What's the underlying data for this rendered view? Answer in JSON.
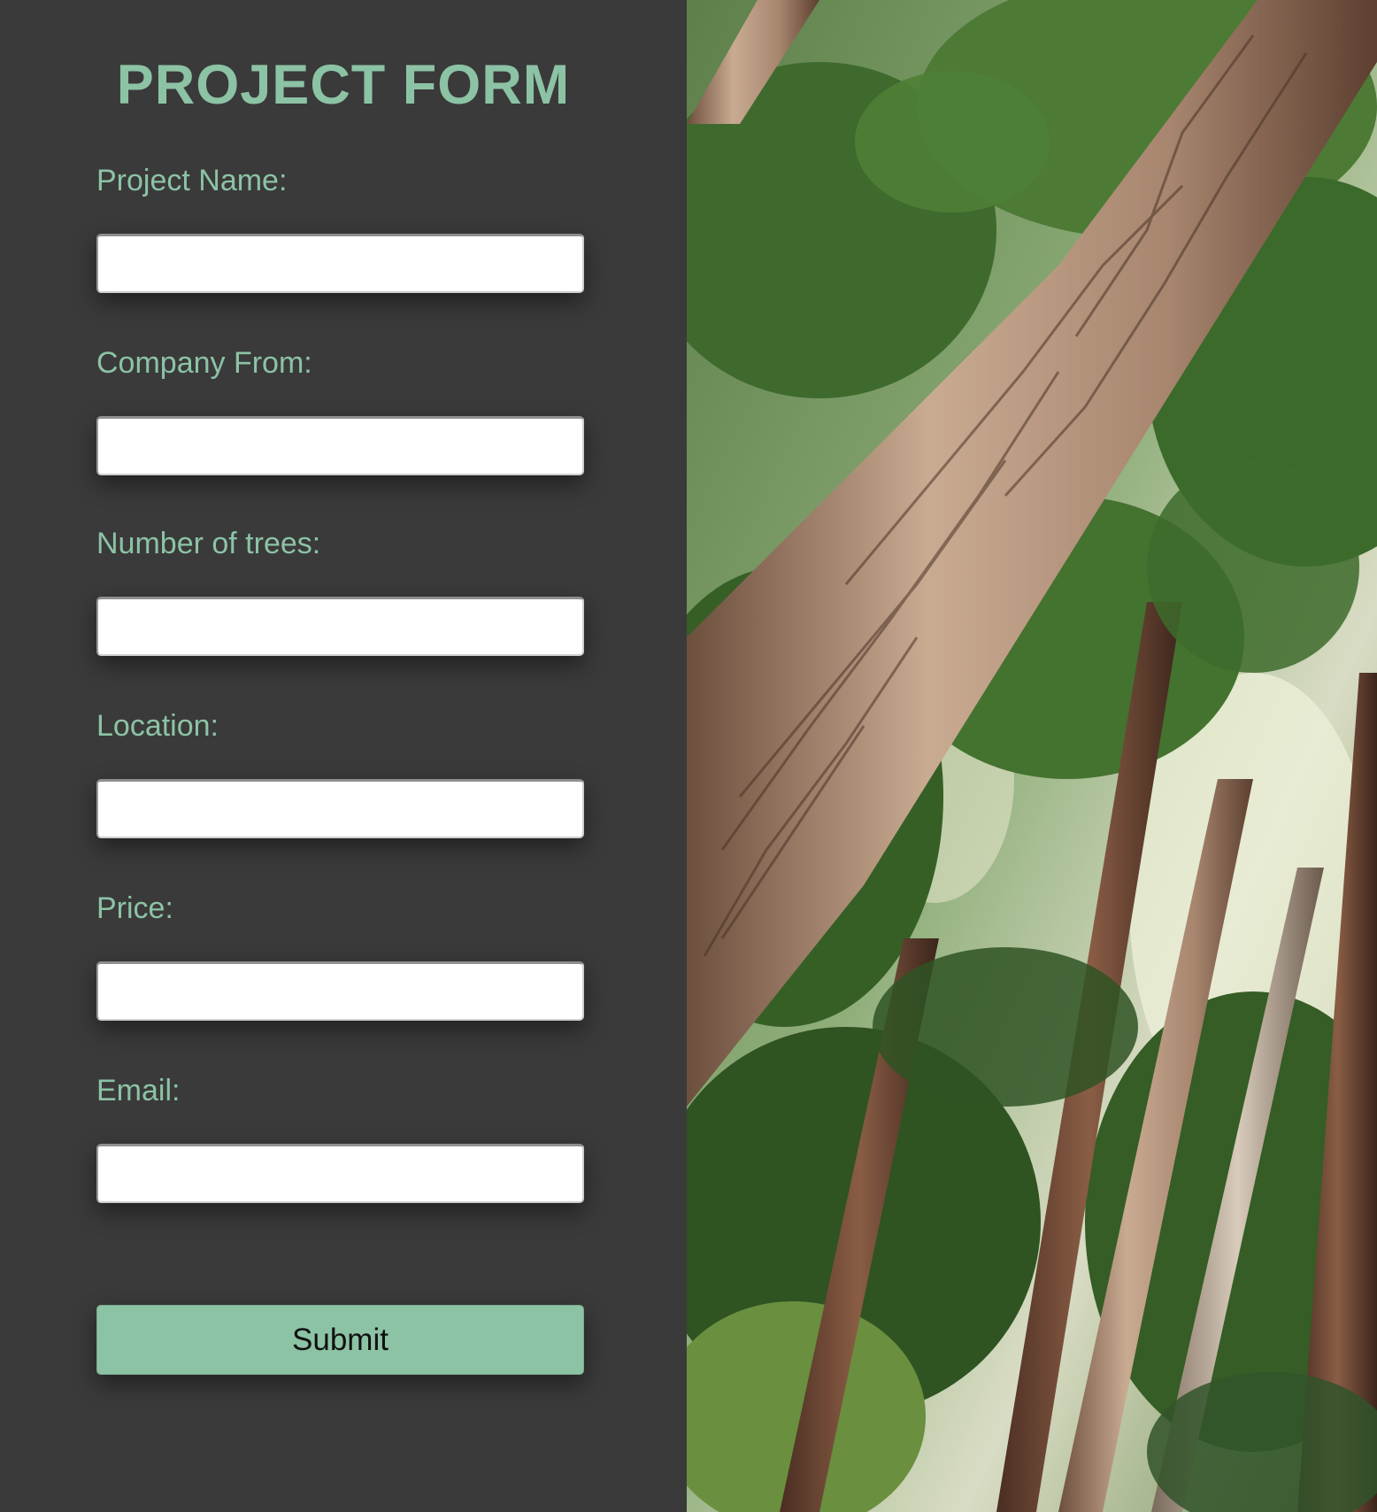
{
  "form": {
    "title": "PROJECT FORM",
    "fields": [
      {
        "label": "Project Name:",
        "value": ""
      },
      {
        "label": "Company From:",
        "value": ""
      },
      {
        "label": "Number of trees:",
        "value": ""
      },
      {
        "label": "Location:",
        "value": ""
      },
      {
        "label": "Price:",
        "value": ""
      },
      {
        "label": "Email:",
        "value": ""
      }
    ],
    "submit_label": "Submit"
  },
  "colors": {
    "panel_background": "#3a3a3a",
    "accent": "#8cc3a5",
    "input_background": "#ffffff"
  },
  "photo": {
    "subject": "forest-trees-photo"
  }
}
